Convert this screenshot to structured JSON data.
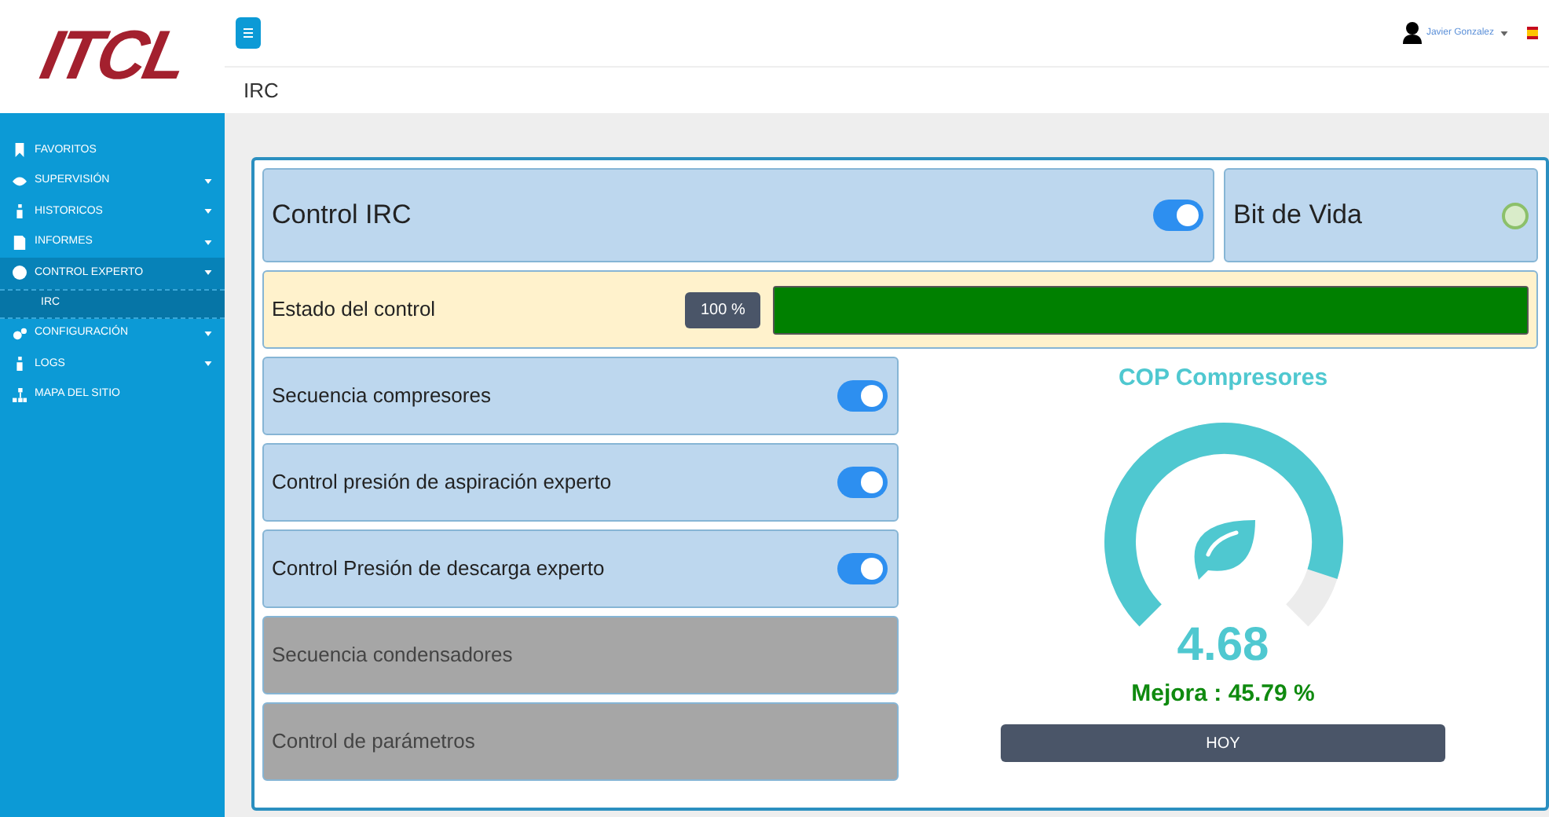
{
  "logo": "ITCL",
  "header": {
    "user": "Javier Gonzalez",
    "breadcrumb": "IRC"
  },
  "sidebar": {
    "items": [
      {
        "label": "FAVORITOS",
        "selected": false,
        "has_caret": false
      },
      {
        "label": "SUPERVISIÓN",
        "selected": false,
        "has_caret": true
      },
      {
        "label": "HISTORICOS",
        "selected": false,
        "has_caret": true
      },
      {
        "label": "INFORMES",
        "selected": false,
        "has_caret": true
      },
      {
        "label": "CONTROL EXPERTO",
        "selected": true,
        "has_caret": true,
        "children": [
          {
            "label": "IRC",
            "selected": true
          }
        ]
      },
      {
        "label": "CONFIGURACIÓN",
        "selected": false,
        "has_caret": true
      },
      {
        "label": "LOGS",
        "selected": false,
        "has_caret": true
      },
      {
        "label": "MAPA DEL SITIO",
        "selected": false,
        "has_caret": false
      }
    ]
  },
  "control": {
    "label": "Control IRC",
    "on": true
  },
  "heartbeat": {
    "label": "Bit de Vida",
    "on": false
  },
  "status": {
    "label": "Estado del control",
    "reading": "100 %",
    "level": 1.0
  },
  "functions": [
    {
      "label": "Secuencia compresores",
      "disabled": false,
      "on": true
    },
    {
      "label": "Control presión de aspiración experto",
      "disabled": false,
      "on": true
    },
    {
      "label": "Control Presión de descarga experto",
      "disabled": false,
      "on": true
    },
    {
      "label": "Secuencia condensadores",
      "disabled": true
    },
    {
      "label": "Control de parámetros",
      "disabled": true
    }
  ],
  "gauge": {
    "title": "COP Compresores",
    "value": "4.68",
    "improvement": "Mejora : 45.79 %",
    "button": "HOY"
  }
}
